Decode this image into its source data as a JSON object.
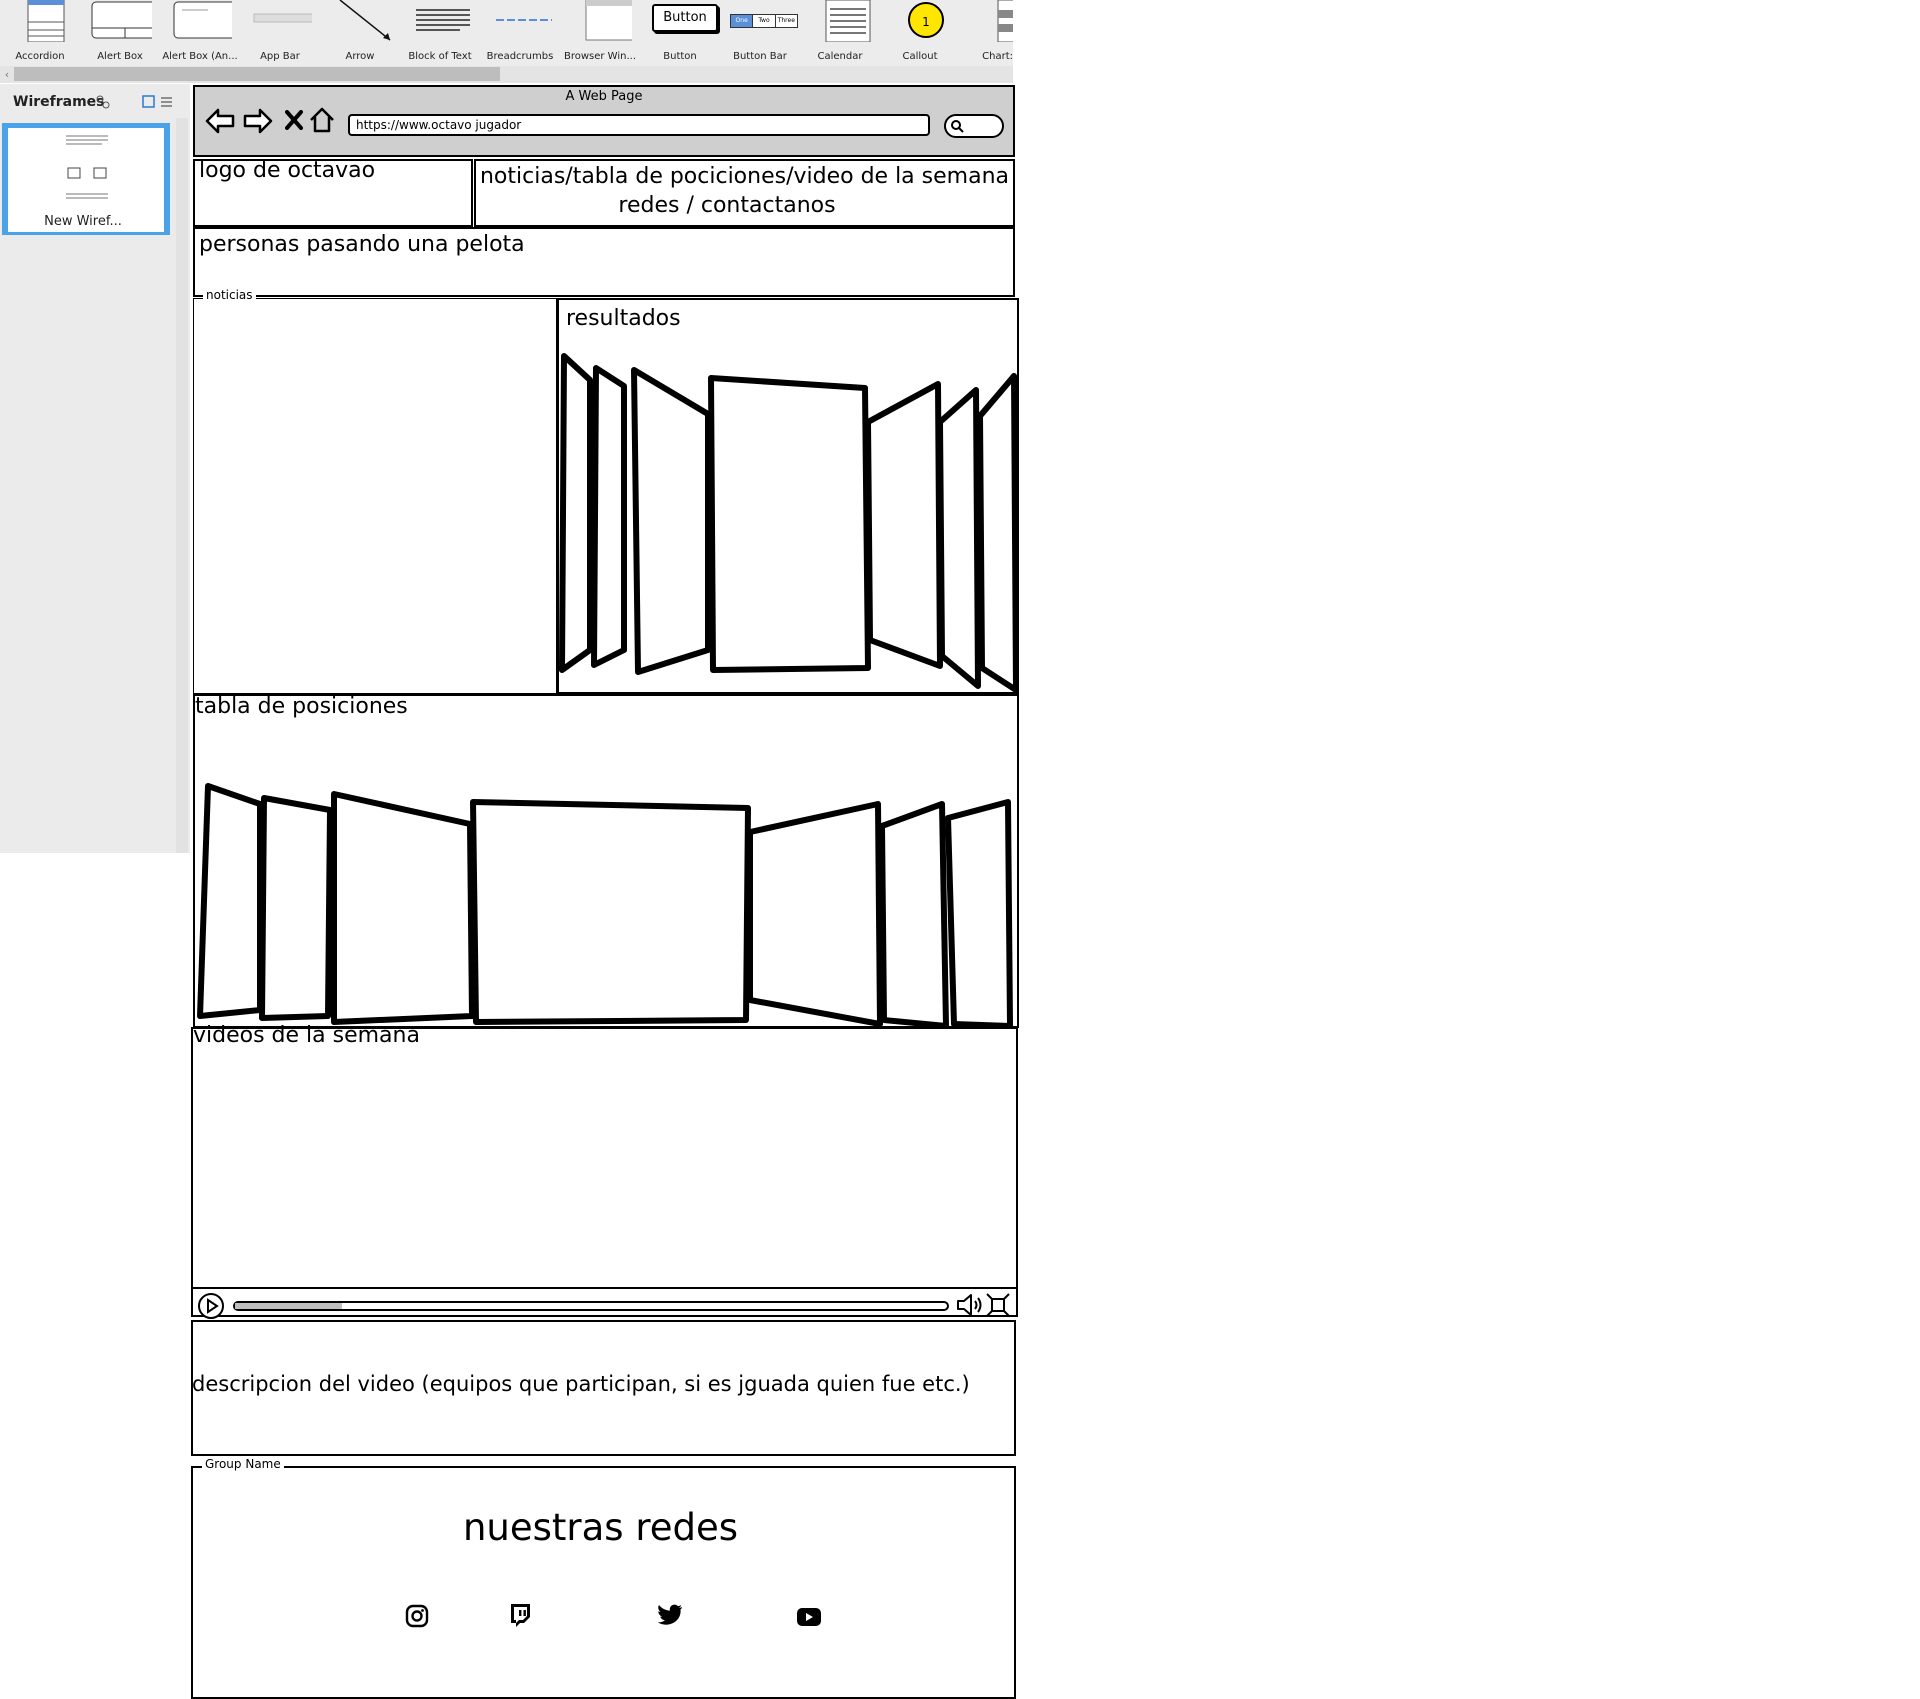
{
  "library": {
    "items": [
      {
        "label": "Accordion"
      },
      {
        "label": "Alert Box"
      },
      {
        "label": "Alert Box (An..."
      },
      {
        "label": "App Bar"
      },
      {
        "label": "Arrow"
      },
      {
        "label": "Block of Text"
      },
      {
        "label": "Breadcrumbs"
      },
      {
        "label": "Browser Win..."
      },
      {
        "label": "Button",
        "thumb_text": "Button"
      },
      {
        "label": "Button Bar",
        "thumb_tabs": [
          "One",
          "Two",
          "Three"
        ]
      },
      {
        "label": "Calendar"
      },
      {
        "label": "Callout",
        "thumb_text": "1",
        "accent": "#ffe600"
      },
      {
        "label": "Chart:"
      }
    ]
  },
  "left_panel": {
    "title": "Wireframes",
    "wireframes": [
      {
        "label": "New Wiref..."
      }
    ],
    "accent": "#4aa3e8"
  },
  "browser": {
    "title": "A Web Page",
    "url": "https://www.octavo jugador"
  },
  "wireframe": {
    "logo_text": "logo de octavao",
    "nav_line1": "noticias/tabla de pociciones/video de la semana",
    "nav_line2": "redes / contactanos",
    "hero_text": "personas pasando una pelota",
    "news_group_label": "noticias",
    "results_title": "resultados",
    "standings_title": "tabla de posiciones",
    "videos_title": "videos de la semana",
    "video_description": "descripcion del video (equipos que participan, si es jguada quien fue etc.)",
    "video_progress": 0.15,
    "social_group_label": "Group Name",
    "social_title": "nuestras redes",
    "social_icons": [
      "instagram-icon",
      "twitch-icon",
      "twitter-icon",
      "youtube-icon"
    ]
  }
}
